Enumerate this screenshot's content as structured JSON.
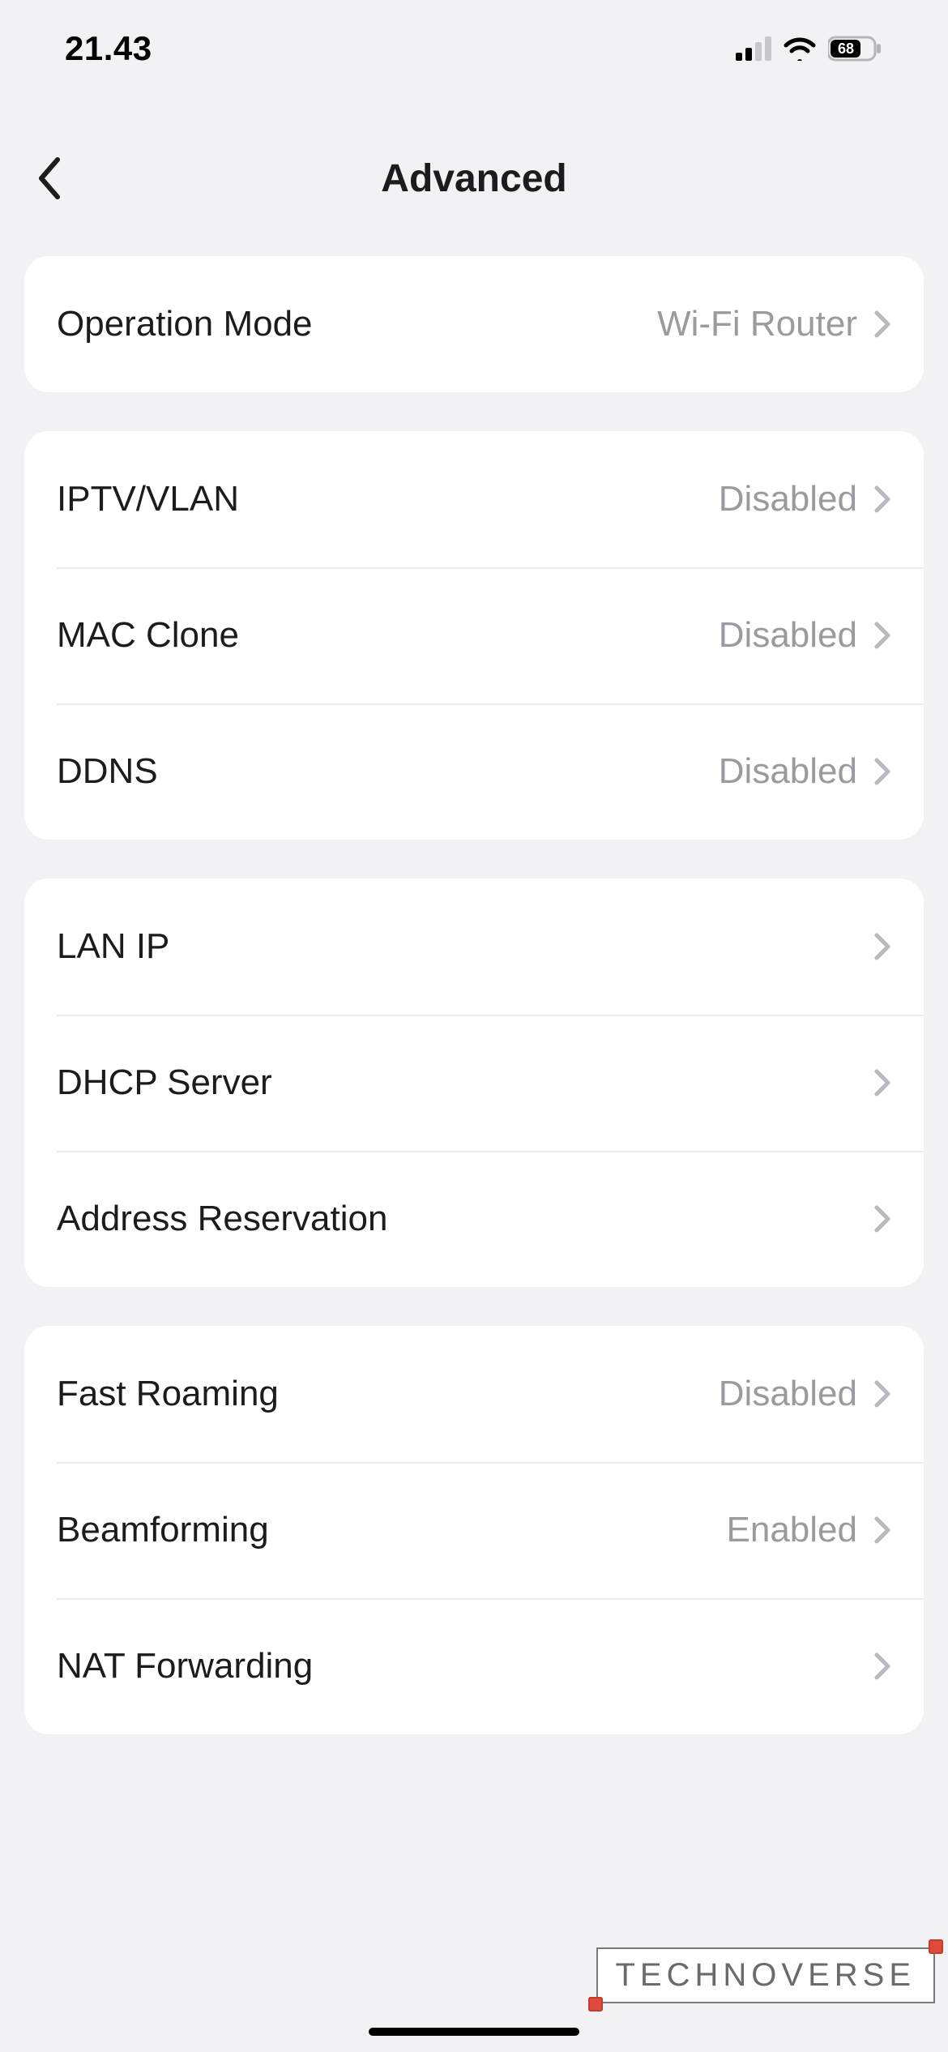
{
  "status_bar": {
    "time": "21.43",
    "battery_percent": "68"
  },
  "nav": {
    "title": "Advanced"
  },
  "groups": [
    {
      "rows": [
        {
          "label": "Operation Mode",
          "value": "Wi-Fi Router"
        }
      ]
    },
    {
      "rows": [
        {
          "label": "IPTV/VLAN",
          "value": "Disabled"
        },
        {
          "label": "MAC Clone",
          "value": "Disabled"
        },
        {
          "label": "DDNS",
          "value": "Disabled"
        }
      ]
    },
    {
      "rows": [
        {
          "label": "LAN IP",
          "value": ""
        },
        {
          "label": "DHCP Server",
          "value": ""
        },
        {
          "label": "Address Reservation",
          "value": ""
        }
      ]
    },
    {
      "rows": [
        {
          "label": "Fast Roaming",
          "value": "Disabled"
        },
        {
          "label": "Beamforming",
          "value": "Enabled"
        },
        {
          "label": "NAT Forwarding",
          "value": ""
        }
      ]
    }
  ],
  "watermark": "TECHNOVERSE"
}
